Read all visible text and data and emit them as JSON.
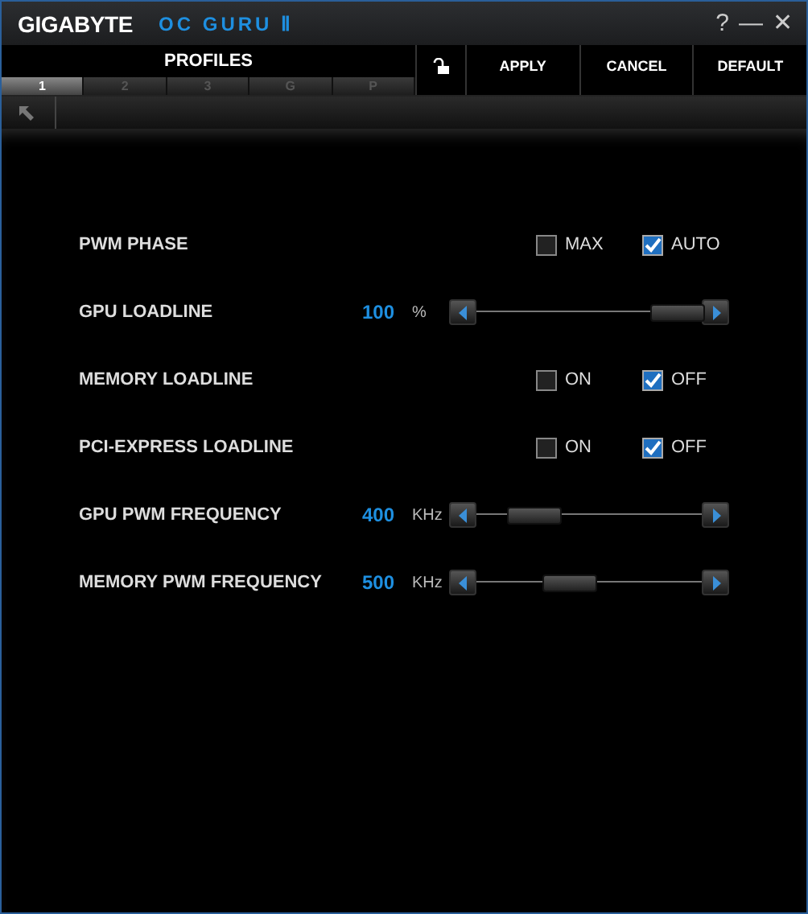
{
  "window": {
    "brand": "GIGABYTE",
    "title": "OC GURU Ⅱ",
    "help": "?",
    "minimize": "—",
    "close": "✕"
  },
  "profiles": {
    "label": "PROFILES",
    "tabs": [
      {
        "label": "1",
        "selected": true
      },
      {
        "label": "2",
        "selected": false
      },
      {
        "label": "3",
        "selected": false
      },
      {
        "label": "G",
        "selected": false
      },
      {
        "label": "P",
        "selected": false
      }
    ]
  },
  "toolbar": {
    "buttons": [
      "APPLY",
      "CANCEL",
      "DEFAULT"
    ]
  },
  "settings": [
    {
      "kind": "checkboxes",
      "label": "PWM PHASE",
      "options": [
        {
          "label": "MAX",
          "checked": false
        },
        {
          "label": "AUTO",
          "checked": true
        }
      ]
    },
    {
      "kind": "slider",
      "label": "GPU LOADLINE",
      "value": "100",
      "unit": "%",
      "level": 1.0
    },
    {
      "kind": "checkboxes",
      "label": "MEMORY LOADLINE",
      "options": [
        {
          "label": "ON",
          "checked": false
        },
        {
          "label": "OFF",
          "checked": true
        }
      ]
    },
    {
      "kind": "checkboxes",
      "label": "PCI-EXPRESS LOADLINE",
      "options": [
        {
          "label": "ON",
          "checked": false
        },
        {
          "label": "OFF",
          "checked": true
        }
      ]
    },
    {
      "kind": "slider",
      "label": "GPU PWM FREQUENCY",
      "value": "400",
      "unit": "KHz",
      "level": 0.18
    },
    {
      "kind": "slider",
      "label": "MEMORY PWM FREQUENCY",
      "value": "500",
      "unit": "KHz",
      "level": 0.38
    }
  ]
}
